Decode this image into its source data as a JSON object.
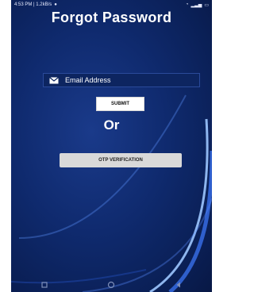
{
  "status_bar": {
    "time_network": "4:53 PM | 1.2kB/s",
    "right_icons": "wifi signal battery"
  },
  "title": "Forgot Password",
  "email_field": {
    "placeholder": "Email Address",
    "value": ""
  },
  "submit_label": "SUBMIT",
  "or_label": "Or",
  "otp_label": "OTP VERIFICATION",
  "nav_bar": {
    "icons": [
      "recents-icon",
      "home-icon",
      "back-icon"
    ]
  },
  "colors": {
    "background": "#0f2a6e",
    "swoosh": "#7fb2ff",
    "button_otp": "#d9d9d9"
  }
}
